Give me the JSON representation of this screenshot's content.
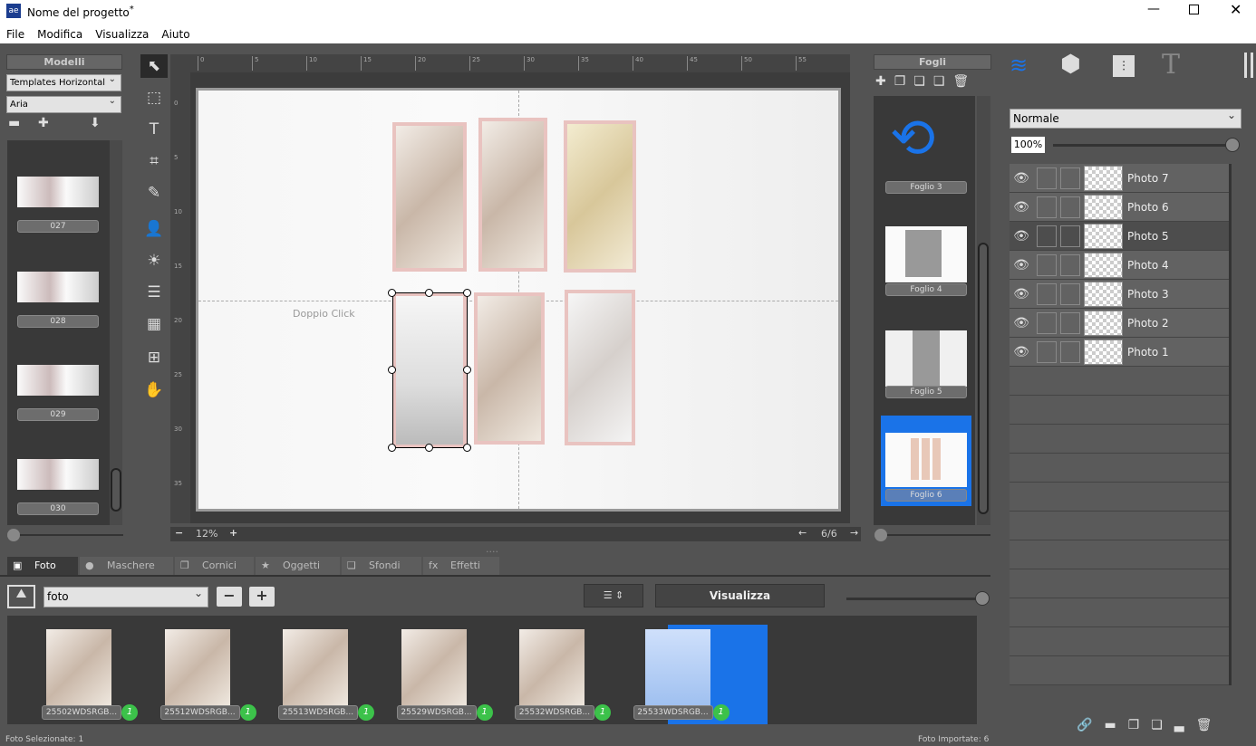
{
  "window": {
    "title": "Nome del progetto",
    "modified_mark": "*",
    "controls": [
      "minimize",
      "maximize",
      "close"
    ]
  },
  "menu": [
    "File",
    "Modifica",
    "Visualizza",
    "Aiuto"
  ],
  "models": {
    "header": "Modelli",
    "template_select": "Templates Horizontal",
    "style_select": "Aria",
    "items": [
      "027",
      "028",
      "029",
      "030"
    ]
  },
  "tools": [
    "select-move-icon",
    "marquee-icon",
    "text-icon",
    "crop-icon",
    "brush-icon",
    "person-icon",
    "brightness-icon",
    "list-icon",
    "grid-icon",
    "grid-download-icon",
    "hand-icon"
  ],
  "ruler": {
    "top": [
      "0",
      "5",
      "10",
      "15",
      "20",
      "25",
      "30",
      "35",
      "40",
      "45",
      "50",
      "55"
    ],
    "left": [
      "0",
      "5",
      "10",
      "15",
      "20",
      "25",
      "30",
      "35"
    ]
  },
  "canvas": {
    "placeholder": "Doppio Click",
    "zoom": "12%",
    "page": "6/6"
  },
  "sheets": {
    "header": "Fogli",
    "items": [
      "Foglio 3",
      "Foglio 4",
      "Foglio 5",
      "Foglio 6"
    ],
    "selected": "Foglio 6"
  },
  "right": {
    "tab_icons": [
      "layers-icon",
      "cube-icon",
      "sliders-icon",
      "text-icon"
    ],
    "blend_mode": "Normale",
    "opacity": "100%",
    "opacity_value": 100,
    "layers": [
      "Photo 7",
      "Photo 6",
      "Photo 5",
      "Photo 4",
      "Photo 3",
      "Photo 2",
      "Photo 1"
    ]
  },
  "bottom": {
    "tabs": [
      "Foto",
      "Maschere",
      "Cornici",
      "Oggetti",
      "Sfondi",
      "Effetti"
    ],
    "active_tab": "Foto",
    "folder": "foto",
    "view_button": "Visualizza",
    "photos": [
      {
        "name": "25502WDSRGB...",
        "count": "1"
      },
      {
        "name": "25512WDSRGB...",
        "count": "1"
      },
      {
        "name": "25513WDSRGB...",
        "count": "1"
      },
      {
        "name": "25529WDSRGB...",
        "count": "1"
      },
      {
        "name": "25532WDSRGB...",
        "count": "1"
      },
      {
        "name": "25533WDSRGB...",
        "count": "1"
      }
    ],
    "status_left": "Foto Selezionate: 1",
    "status_right": "Foto Importate: 6"
  },
  "colors": {
    "accent": "#1a73e8",
    "badge": "#3cc24a",
    "frame": "#e9c3c0"
  }
}
